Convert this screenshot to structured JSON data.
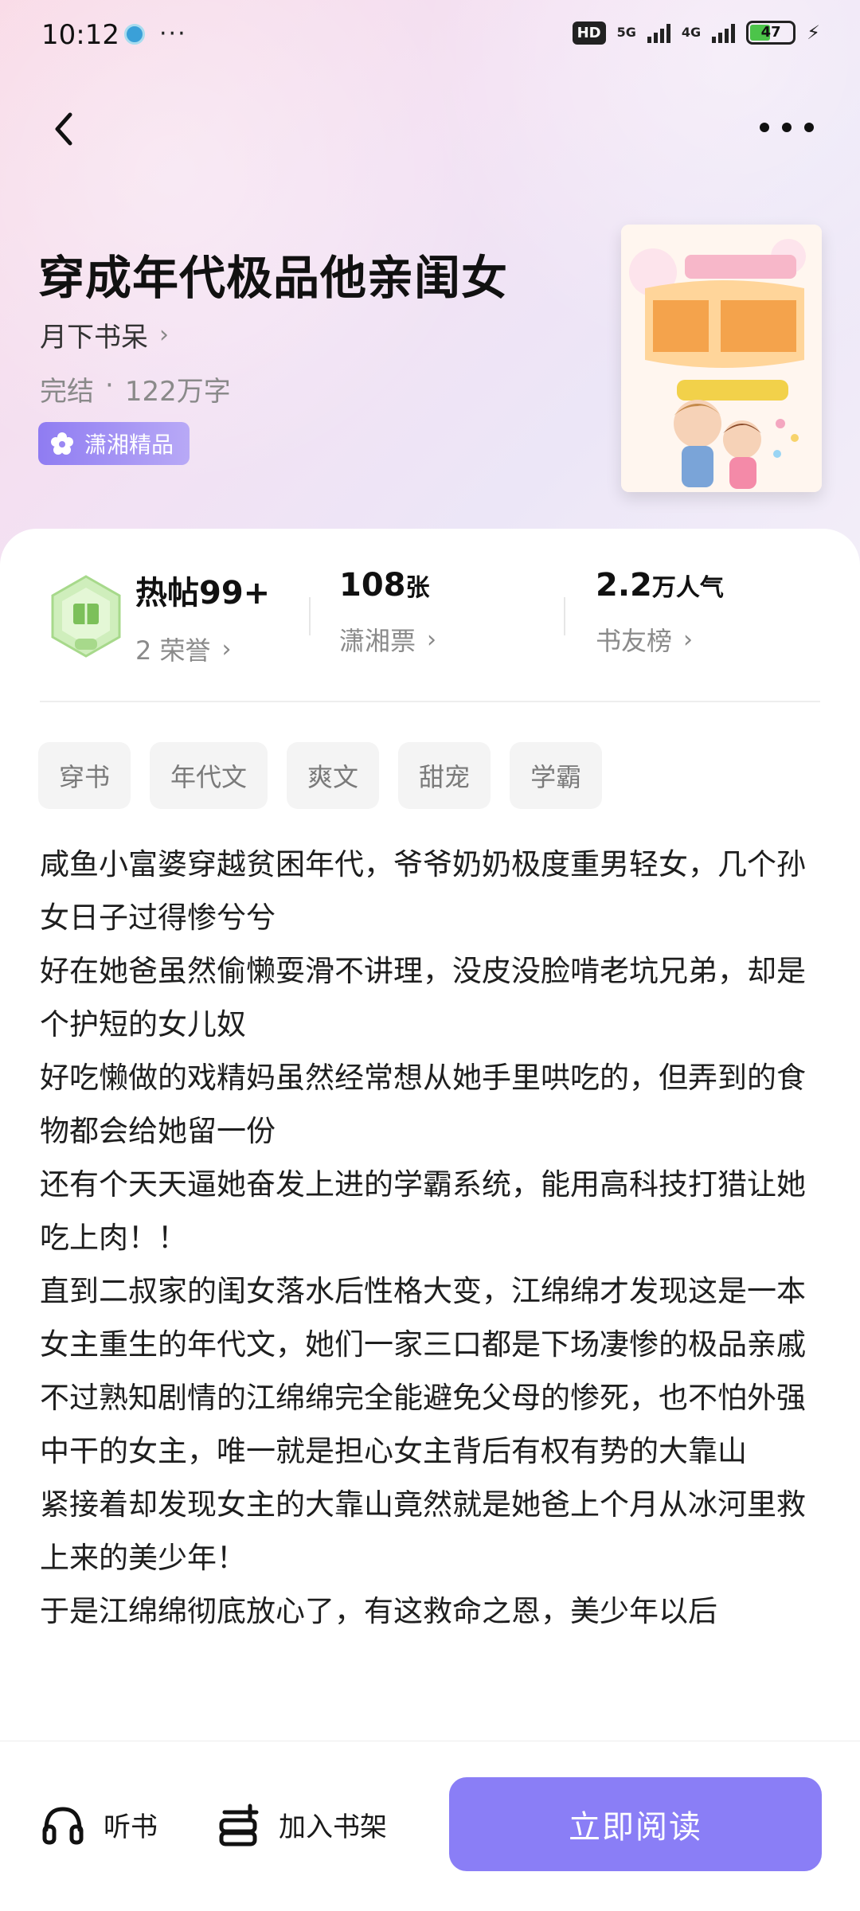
{
  "status_bar": {
    "time": "10:12",
    "more": "···",
    "hd": "HD",
    "net1": "5G",
    "net2": "4G",
    "battery": "47"
  },
  "book": {
    "title": "穿成年代极品他亲闺女",
    "author": "月下书呆",
    "status": "完结",
    "separator": "·",
    "word_count": "122万字",
    "badge": "潇湘精品"
  },
  "stats": {
    "posts": "热帖99+",
    "honors": "2 荣誉",
    "tickets_value": "108",
    "tickets_unit": "张",
    "tickets_label": "潇湘票",
    "popularity_value": "2.2",
    "popularity_unit": "万人气",
    "popularity_label": "书友榜"
  },
  "tags": [
    "穿书",
    "年代文",
    "爽文",
    "甜宠",
    "学霸"
  ],
  "description": [
    "咸鱼小富婆穿越贫困年代，爷爷奶奶极度重男轻女，几个孙女日子过得惨兮兮",
    "好在她爸虽然偷懒耍滑不讲理，没皮没脸啃老坑兄弟，却是个护短的女儿奴",
    "好吃懒做的戏精妈虽然经常想从她手里哄吃的，但弄到的食物都会给她留一份",
    "还有个天天逼她奋发上进的学霸系统，能用高科技打猎让她吃上肉！！",
    "直到二叔家的闺女落水后性格大变，江绵绵才发现这是一本女主重生的年代文，她们一家三口都是下场凄惨的极品亲戚",
    "不过熟知剧情的江绵绵完全能避免父母的惨死，也不怕外强中干的女主，唯一就是担心女主背后有权有势的大靠山",
    "紧接着却发现女主的大靠山竟然就是她爸上个月从冰河里救上来的美少年！",
    "于是江绵绵彻底放心了，有这救命之恩，美少年以后"
  ],
  "bottom": {
    "listen": "听书",
    "add_shelf": "加入书架",
    "read_now": "立即阅读"
  },
  "colors": {
    "accent": "#8a7ef6",
    "badge": "#9a88f3",
    "battery": "#4cc44a"
  }
}
